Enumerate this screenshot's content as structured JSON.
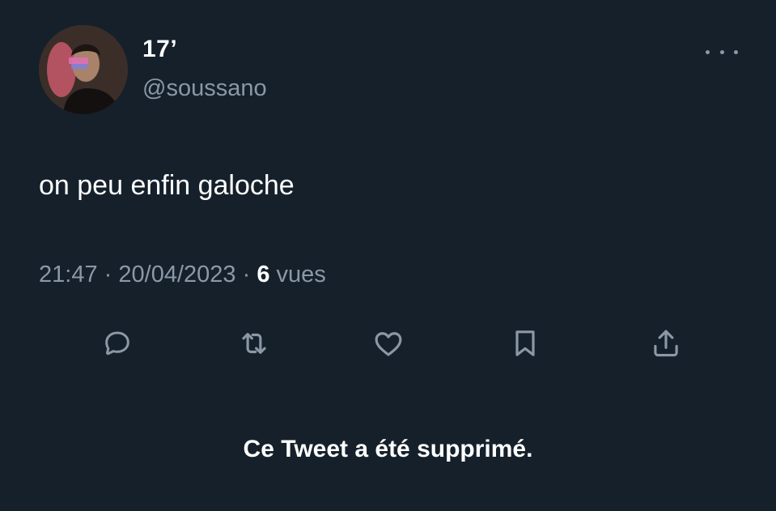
{
  "tweet": {
    "author": {
      "name": "17’",
      "handle": "@soussano",
      "avatar": "profile-photo"
    },
    "text": "on peu enfin galoche",
    "meta": {
      "time": "21:47",
      "separator": "·",
      "date": "20/04/2023",
      "views_count": "6",
      "views_label": "vues"
    },
    "actions": [
      {
        "icon": "reply-icon"
      },
      {
        "icon": "retweet-icon"
      },
      {
        "icon": "like-icon"
      },
      {
        "icon": "bookmark-icon"
      },
      {
        "icon": "share-icon"
      }
    ],
    "more_icon": "more-options-icon",
    "status": "Ce Tweet a été supprimé."
  },
  "colors": {
    "background": "#15202b",
    "primary_text": "#ffffff",
    "secondary_text": "#8b98a5",
    "icon": "#8b98a5"
  }
}
